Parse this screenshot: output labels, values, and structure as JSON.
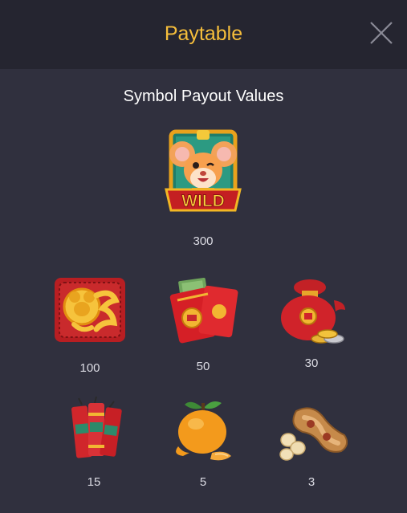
{
  "header": {
    "title": "Paytable",
    "close_icon": "close-icon"
  },
  "section": {
    "title": "Symbol Payout Values"
  },
  "symbols": [
    {
      "name": "wild",
      "label": "WILD",
      "icon": "mouse-wild-icon",
      "payout": "300"
    },
    {
      "name": "golden-mouse-emblem",
      "icon": "golden-mouse-emblem-icon",
      "payout": "100"
    },
    {
      "name": "red-envelopes",
      "icon": "red-envelope-money-icon",
      "payout": "50"
    },
    {
      "name": "lucky-bag",
      "icon": "lucky-bag-coins-icon",
      "payout": "30"
    },
    {
      "name": "firecrackers",
      "icon": "firecrackers-icon",
      "payout": "15"
    },
    {
      "name": "orange",
      "icon": "mandarin-orange-icon",
      "payout": "5"
    },
    {
      "name": "peanuts",
      "icon": "peanuts-icon",
      "payout": "3"
    }
  ],
  "colors": {
    "accent": "#f6be3b",
    "header_bg": "#252530",
    "panel_bg": "#30303e"
  }
}
